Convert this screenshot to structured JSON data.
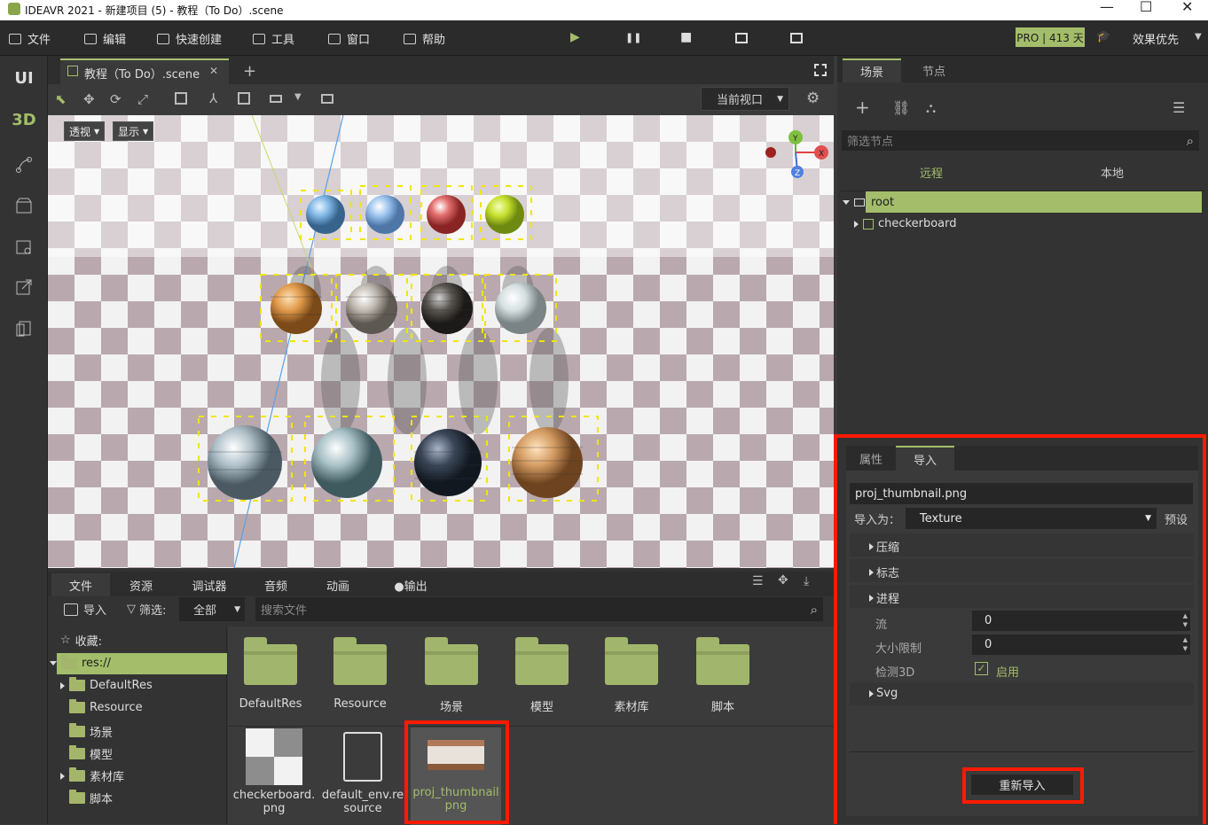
{
  "window": {
    "title": "IDEAVR 2021 - 新建项目 (5) - 教程（To Do）.scene",
    "minimize": "—",
    "maximize": "☐",
    "close": "✕"
  },
  "menu": {
    "items": [
      {
        "label": "文件"
      },
      {
        "label": "编辑"
      },
      {
        "label": "快速创建"
      },
      {
        "label": "工具"
      },
      {
        "label": "窗口"
      },
      {
        "label": "帮助"
      }
    ],
    "play": "▶",
    "pause": "❚❚",
    "stop": "■",
    "pro_badge": "PRO | 413 天",
    "quality": "效果优先"
  },
  "leftbar": {
    "ui": "UI",
    "three_d": "3D"
  },
  "scene_tab": {
    "label": "教程（To Do）.scene",
    "close": "✕",
    "add": "+"
  },
  "viewport_toolbar": {
    "current_view": "当前视口"
  },
  "viewport": {
    "perspective": "透视",
    "display": "显示"
  },
  "bottom_tabs": [
    {
      "label": "文件"
    },
    {
      "label": "资源"
    },
    {
      "label": "调试器"
    },
    {
      "label": "音频"
    },
    {
      "label": "动画"
    },
    {
      "label": "●输出"
    }
  ],
  "files": {
    "import_label": "导入",
    "filter_label": "筛选:",
    "filter_value": "全部",
    "search_placeholder": "搜索文件",
    "favorites": "收藏:",
    "tree": [
      {
        "label": "res://"
      },
      {
        "label": "DefaultRes"
      },
      {
        "label": "Resource"
      },
      {
        "label": "场景"
      },
      {
        "label": "模型"
      },
      {
        "label": "素材库"
      },
      {
        "label": "脚本"
      }
    ],
    "folders": [
      {
        "label": "DefaultRes"
      },
      {
        "label": "Resource"
      },
      {
        "label": "场景"
      },
      {
        "label": "模型"
      },
      {
        "label": "素材库"
      },
      {
        "label": "脚本"
      }
    ],
    "assets": [
      {
        "label1": "checkerboard.",
        "label2": "png"
      },
      {
        "label1": "default_env.re",
        "label2": "source"
      },
      {
        "label1": "proj_thumbnail",
        "label2": "png"
      }
    ]
  },
  "scene_panel": {
    "tabs": [
      {
        "label": "场景"
      },
      {
        "label": "节点"
      }
    ],
    "filter_placeholder": "筛选节点",
    "remote": "远程",
    "local": "本地",
    "nodes": [
      {
        "label": "root"
      },
      {
        "label": "checkerboard"
      }
    ]
  },
  "inspector": {
    "tabs": [
      {
        "label": "属性"
      },
      {
        "label": "导入"
      }
    ],
    "file": "proj_thumbnail.png",
    "import_as_label": "导入为：",
    "import_as_value": "Texture",
    "preset": "预设",
    "sections": [
      {
        "label": "压缩"
      },
      {
        "label": "标志"
      },
      {
        "label": "进程"
      }
    ],
    "stream_label": "流",
    "stream_value": "0",
    "size_limit_label": "大小限制",
    "size_limit_value": "0",
    "detect3d_label": "检测3D",
    "detect3d_value": "启用",
    "svg_section": "Svg",
    "reimport": "重新导入"
  },
  "colors": {
    "accent": "#a3bd6a",
    "highlight_red": "#ff1a00"
  }
}
